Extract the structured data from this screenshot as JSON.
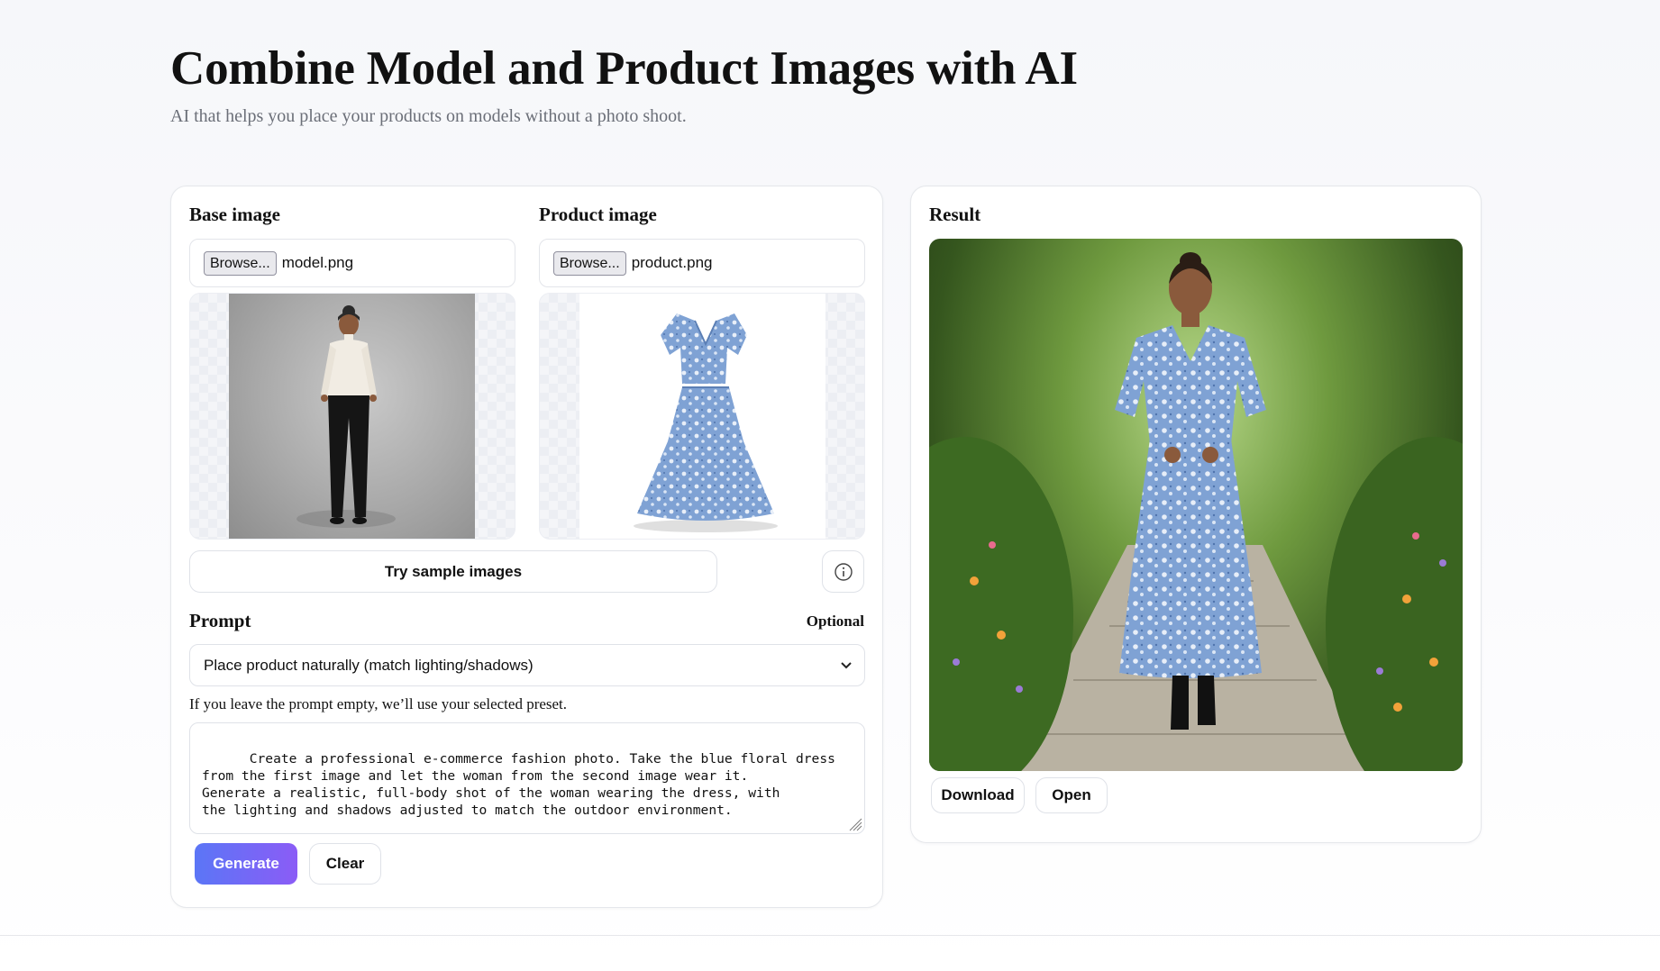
{
  "hero": {
    "title": "Combine Model and Product Images with AI",
    "subtitle": "AI that helps you place your products on models without a photo shoot."
  },
  "base": {
    "label": "Base image",
    "browse_label": "Browse...",
    "filename": "model.png"
  },
  "product": {
    "label": "Product image",
    "browse_label": "Browse...",
    "filename": "product.png"
  },
  "sample_button": "Try sample images",
  "prompt": {
    "label": "Prompt",
    "optional": "Optional",
    "preset_selected": "Place product naturally (match lighting/shadows)",
    "helper": "If you leave the prompt empty, we’ll use your selected preset.",
    "text": "Create a professional e-commerce fashion photo. Take the blue floral dress\nfrom the first image and let the woman from the second image wear it.\nGenerate a realistic, full-body shot of the woman wearing the dress, with\nthe lighting and shadows adjusted to match the outdoor environment."
  },
  "actions": {
    "generate": "Generate",
    "clear": "Clear"
  },
  "result": {
    "label": "Result",
    "download": "Download",
    "open": "Open"
  },
  "colors": {
    "accent_start": "#5b76f6",
    "accent_end": "#8b5cf6",
    "dress_blue": "#7fa2d4",
    "sweater": "#f1ece3"
  },
  "icons": {
    "info": "info-circle-icon",
    "chevron": "chevron-down-icon"
  }
}
